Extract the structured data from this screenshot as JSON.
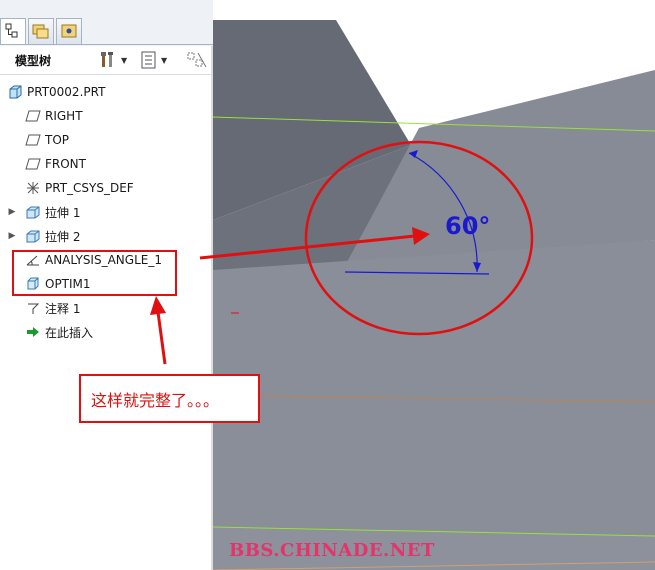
{
  "panel": {
    "tabs": [
      {
        "icon": "model-tree-tab-icon",
        "active": true
      },
      {
        "icon": "folder-browser-tab-icon",
        "active": false
      },
      {
        "icon": "favorites-tab-icon",
        "active": false
      }
    ],
    "title": "模型树",
    "tools": [
      {
        "icon": "settings-tools-icon"
      },
      {
        "icon": "show-options-icon"
      },
      {
        "icon": "filter-icon"
      }
    ]
  },
  "tree": [
    {
      "label": "PRT0002.PRT",
      "icon": "part-icon",
      "expandable": false,
      "indent": 0
    },
    {
      "label": "RIGHT",
      "icon": "datum-plane-icon",
      "expandable": false,
      "indent": 1
    },
    {
      "label": "TOP",
      "icon": "datum-plane-icon",
      "expandable": false,
      "indent": 1
    },
    {
      "label": "FRONT",
      "icon": "datum-plane-icon",
      "expandable": false,
      "indent": 1
    },
    {
      "label": "PRT_CSYS_DEF",
      "icon": "csys-icon",
      "expandable": false,
      "indent": 1
    },
    {
      "label": "拉伸 1",
      "icon": "extrude-icon",
      "expandable": true,
      "indent": 1
    },
    {
      "label": "拉伸 2",
      "icon": "extrude-icon",
      "expandable": true,
      "indent": 1
    },
    {
      "label": "ANALYSIS_ANGLE_1",
      "icon": "analysis-angle-icon",
      "expandable": false,
      "indent": 1
    },
    {
      "label": "OPTIM1",
      "icon": "optimization-icon",
      "expandable": false,
      "indent": 1
    },
    {
      "label": "注释 1",
      "icon": "annotation-icon",
      "expandable": false,
      "indent": 1
    },
    {
      "label": "在此插入",
      "icon": "insert-here-arrow-icon",
      "expandable": false,
      "indent": 1
    }
  ],
  "viewport": {
    "angle_label": "60°",
    "colors": {
      "model_light": "#868b96",
      "model_dark": "#656a74",
      "dim_blue": "#1a1acc",
      "datum_green": "#9be03a",
      "datum_orange": "#c0805a"
    }
  },
  "annotation": {
    "note": "这样就完整了。。。",
    "color": "#e01010"
  },
  "watermark": "BBS.CHINADE.NET"
}
